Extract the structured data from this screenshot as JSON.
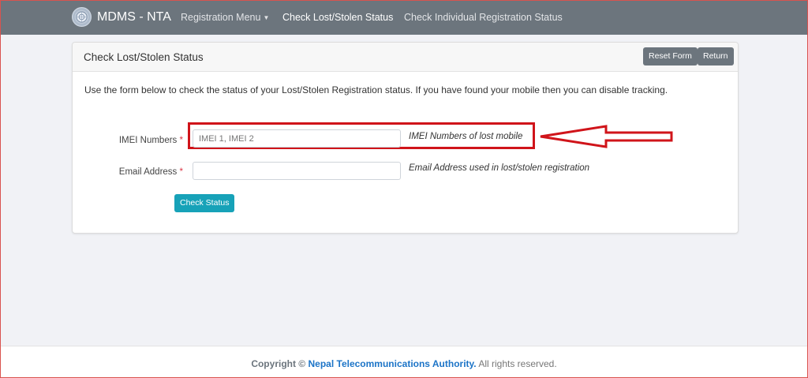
{
  "navbar": {
    "brand": "MDMS - NTA",
    "links": [
      {
        "label": "Registration Menu"
      },
      {
        "label": "Check Lost/Stolen Status"
      },
      {
        "label": "Check Individual Registration Status"
      }
    ]
  },
  "card": {
    "title": "Check Lost/Stolen Status",
    "reset_label": "Reset Form",
    "return_label": "Return",
    "intro": "Use the form below to check the status of your Lost/Stolen Registration status. If you have found your mobile then you can disable tracking."
  },
  "form": {
    "imei_label": "IMEI Numbers",
    "imei_placeholder": "IMEI 1, IMEI 2",
    "imei_help": "IMEI Numbers of lost mobile",
    "email_label": "Email Address",
    "email_placeholder": "",
    "email_help": "Email Address used in lost/stolen registration",
    "required_mark": "*",
    "submit_label": "Check Status"
  },
  "footer": {
    "copyright": "Copyright ©",
    "org": "Nepal Telecommunications Authority.",
    "rights": "All rights reserved."
  },
  "colors": {
    "navbar": "#6c757d",
    "accent_button": "#17a2b8",
    "highlight": "#d0141a",
    "link": "#1c74c7"
  }
}
